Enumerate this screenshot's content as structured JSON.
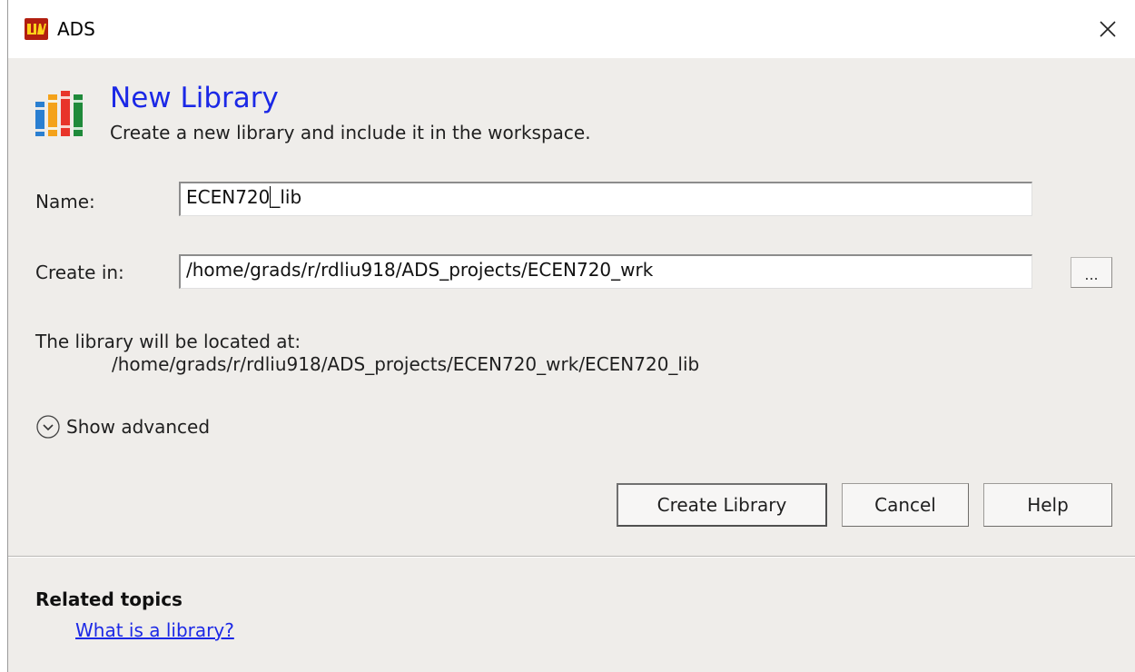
{
  "window": {
    "title": "ADS",
    "app_icon": "ads-logo-icon",
    "close_icon": "close-icon"
  },
  "header": {
    "icon": "library-books-icon",
    "title": "New Library",
    "subtitle": "Create a new library and include it in the workspace."
  },
  "form": {
    "name_label": "Name:",
    "name_value_before_caret": "ECEN720",
    "name_value_after_caret": "_lib",
    "create_in_label": "Create in:",
    "create_in_value": "/home/grads/r/rdliu918/ADS_projects/ECEN720_wrk",
    "browse_label": "...",
    "location_label": "The library will be located at:",
    "location_path": "/home/grads/r/rdliu918/ADS_projects/ECEN720_wrk/ECEN720_lib"
  },
  "advanced": {
    "icon": "chevron-down-circle-icon",
    "label": "Show advanced"
  },
  "buttons": {
    "create": "Create Library",
    "cancel": "Cancel",
    "help": "Help"
  },
  "related": {
    "title": "Related topics",
    "link": "What is a library?"
  },
  "colors": {
    "dialog_bg": "#efedea",
    "accent_blue": "#1b28e6",
    "app_icon_red": "#b21f10"
  }
}
